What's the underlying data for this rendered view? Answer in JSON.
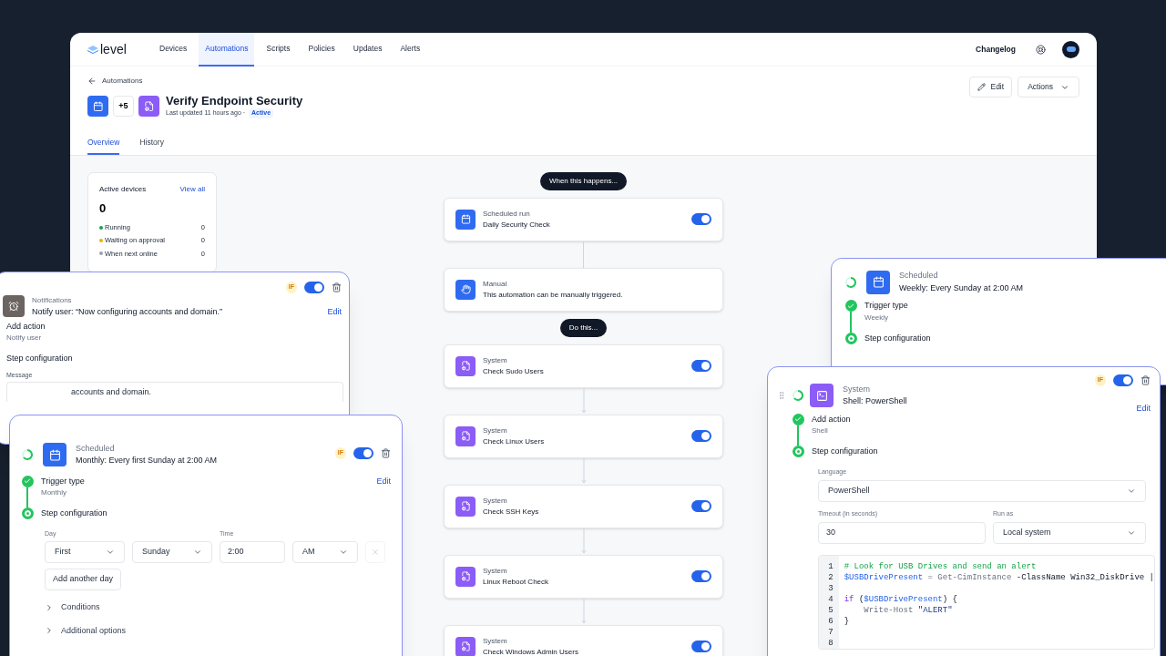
{
  "nav": {
    "logo": "level",
    "tabs": [
      {
        "label": "Devices",
        "selected": false
      },
      {
        "label": "Automations",
        "selected": true
      },
      {
        "label": "Scripts",
        "selected": false
      },
      {
        "label": "Policies",
        "selected": false
      },
      {
        "label": "Updates",
        "selected": false
      },
      {
        "label": "Alerts",
        "selected": false
      }
    ],
    "changelog": "Changelog"
  },
  "header": {
    "back": "Automations",
    "more_badge": "+5",
    "title": "Verify Endpoint Security",
    "updated": "Last updated 11 hours ago ·",
    "status": "Active",
    "edit": "Edit",
    "actions": "Actions"
  },
  "page_tabs": [
    {
      "label": "Overview",
      "selected": true
    },
    {
      "label": "History",
      "selected": false
    }
  ],
  "active_devices": {
    "title": "Active devices",
    "link": "View all",
    "count": "0",
    "rows": [
      {
        "label": "Running",
        "value": "0",
        "color": "#16a34a"
      },
      {
        "label": "Waiting on approval",
        "value": "0",
        "color": "#eab308"
      },
      {
        "label": "When next online",
        "value": "0",
        "color": "#9ca3af"
      }
    ]
  },
  "flow": [
    {
      "kind": "pill",
      "label": "When this happens..."
    },
    {
      "kind": "scheduled",
      "category": "Scheduled run",
      "title": "Daily Security Check",
      "on": true
    },
    {
      "kind": "manual",
      "category": "Manual",
      "title": "This automation can be manually triggered."
    },
    {
      "kind": "pill",
      "label": "Do this..."
    },
    {
      "kind": "action",
      "category": "System",
      "title": "Check Sudo Users",
      "on": true
    },
    {
      "kind": "action",
      "category": "System",
      "title": "Check Linux Users",
      "on": true
    },
    {
      "kind": "action",
      "category": "System",
      "title": "Check SSH Keys",
      "on": true
    },
    {
      "kind": "action",
      "category": "System",
      "title": "Linux Reboot Check",
      "on": true
    },
    {
      "kind": "action",
      "category": "System",
      "title": "Check Windows Admin Users",
      "on": true
    }
  ],
  "notification_card": {
    "category": "Notifications",
    "title": "Notify user: “Now configuring accounts and domain.”",
    "if_badge": "IF",
    "on": true,
    "edit": "Edit",
    "steps": [
      {
        "label": "Add action",
        "sub": "Notify user"
      },
      {
        "label": "Step configuration"
      }
    ],
    "message_label": "Message",
    "message": "accounts and domain."
  },
  "monthly_card": {
    "category": "Scheduled",
    "title": "Monthly: Every first Sunday at 2:00 AM",
    "if_badge": "IF",
    "on": true,
    "edit": "Edit",
    "steps": [
      {
        "label": "Trigger type",
        "sub": "Monthly",
        "done": true
      },
      {
        "label": "Step configuration",
        "done": false
      }
    ],
    "day_label": "Day",
    "ordinal": "First",
    "weekday": "Sunday",
    "time_label": "Time",
    "time": "2:00",
    "period": "AM",
    "add_day": "Add another day",
    "sections": [
      "Conditions",
      "Additional options"
    ]
  },
  "weekly_card": {
    "category": "Scheduled",
    "title": "Weekly: Every Sunday at 2:00 AM",
    "steps": [
      {
        "label": "Trigger type",
        "sub": "Weekly",
        "done": true
      },
      {
        "label": "Step configuration",
        "done": false
      }
    ]
  },
  "shell_card": {
    "category": "System",
    "title": "Shell: PowerShell",
    "if_badge": "IF",
    "on": true,
    "edit": "Edit",
    "steps": [
      {
        "label": "Add action",
        "sub": "Shell",
        "done": true
      },
      {
        "label": "Step configuration",
        "done": false
      }
    ],
    "language_label": "Language",
    "language": "PowerShell",
    "timeout_label": "Timeout (in seconds)",
    "timeout": "30",
    "run_as_label": "Run as",
    "run_as": "Local system",
    "code": [
      {
        "number": "1",
        "tokens": [
          {
            "kind": "comment",
            "text": "# Look for USB Drives and send an alert"
          }
        ]
      },
      {
        "number": "2",
        "tokens": [
          {
            "kind": "variable",
            "text": "$USBDrivePresent"
          },
          {
            "kind": "operator",
            "text": " = "
          },
          {
            "kind": "cmdlet",
            "text": "Get-CimInstance"
          },
          {
            "kind": "plain",
            "text": " -ClassName Win32_DiskDrive |"
          }
        ]
      },
      {
        "number": "3"
      },
      {
        "number": "4",
        "tokens": [
          {
            "kind": "keyword",
            "text": "if"
          },
          {
            "kind": "plain",
            "text": " ("
          },
          {
            "kind": "variable",
            "text": "$USBDrivePresent"
          },
          {
            "kind": "plain",
            "text": ") {"
          }
        ]
      },
      {
        "number": "5",
        "tokens": [
          {
            "kind": "cmdlet",
            "text": "    Write-Host"
          },
          {
            "kind": "string",
            "text": " \"ALERT\""
          }
        ]
      },
      {
        "number": "6",
        "tokens": [
          {
            "kind": "plain",
            "text": "}"
          }
        ]
      },
      {
        "number": "7"
      },
      {
        "number": "8"
      }
    ]
  }
}
